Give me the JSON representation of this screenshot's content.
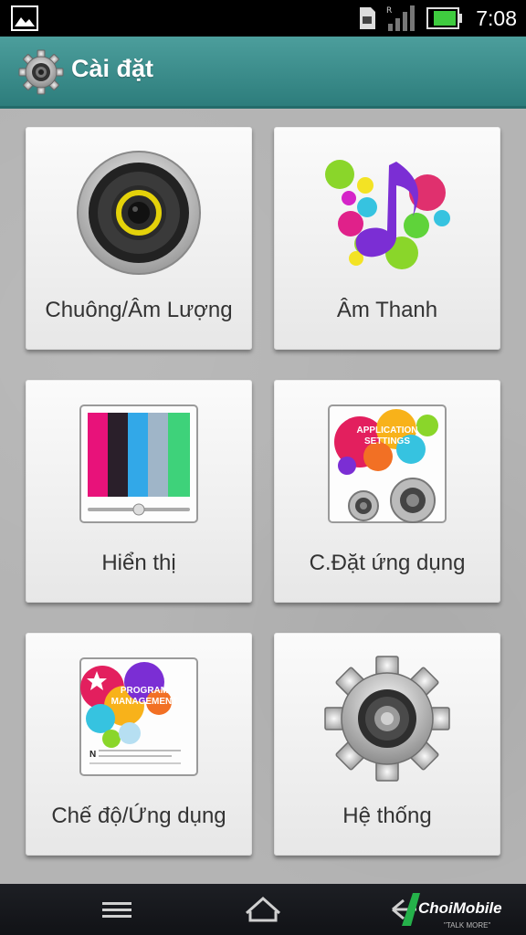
{
  "status_bar": {
    "time": "7:08",
    "icons": [
      "image-icon",
      "sd-card-icon",
      "signal-icon",
      "battery-icon"
    ]
  },
  "app_bar": {
    "title": "Cài đặt",
    "icon": "settings-gear-icon",
    "color": "#3a8d8c"
  },
  "tiles": [
    {
      "label": "Chuông/Âm Lượng",
      "icon": "speaker-icon"
    },
    {
      "label": "Âm Thanh",
      "icon": "music-note-icon"
    },
    {
      "label": "Hiển thị",
      "icon": "display-icon"
    },
    {
      "label": "C.Đặt ứng dụng",
      "icon": "application-settings-icon",
      "icon_text": "APPLICATION SETTINGS"
    },
    {
      "label": "Chế độ/Ứng dụng",
      "icon": "program-management-icon",
      "icon_text": "PROGRAM MANAGEMENT"
    },
    {
      "label": "Hệ thống",
      "icon": "system-gear-icon"
    }
  ],
  "nav_bar": {
    "buttons": [
      "menu-icon",
      "home-icon",
      "back-icon"
    ]
  },
  "watermark": {
    "brand": "ChoiMobile",
    "tagline": "TALK MORE"
  }
}
